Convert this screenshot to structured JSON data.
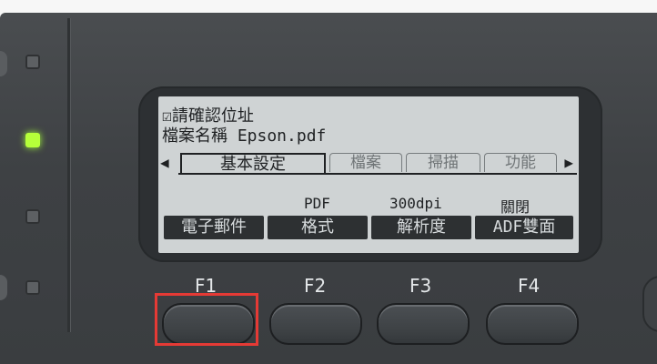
{
  "lcd": {
    "line1": "☑請確認位址",
    "line2": "檔案名稱 Epson.pdf",
    "tabs": {
      "left_arrow": "◀",
      "right_arrow": "▶",
      "items": [
        {
          "label": "基本設定"
        },
        {
          "label": "檔案"
        },
        {
          "label": "掃描"
        },
        {
          "label": "功能"
        }
      ]
    },
    "values": [
      "PDF",
      "300dpi",
      "關閉"
    ],
    "function_labels": [
      "電子郵件",
      "格式",
      "解析度",
      "ADF雙面"
    ]
  },
  "buttons": {
    "labels": [
      "F1",
      "F2",
      "F3",
      "F4"
    ]
  },
  "colors": {
    "led_active": "#b6ff3a",
    "highlight": "#e53a35"
  }
}
